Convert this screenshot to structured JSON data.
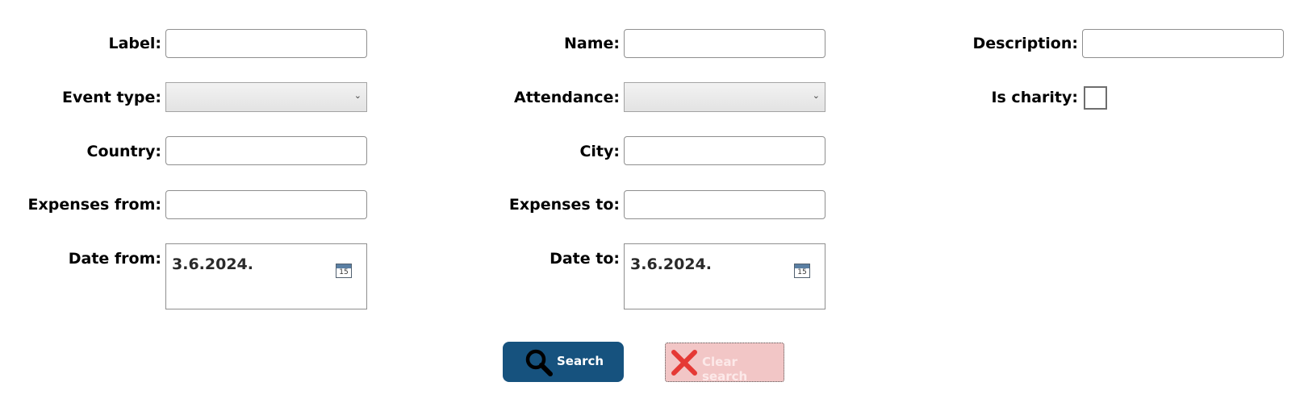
{
  "form": {
    "label_label": "Label:",
    "label_value": "",
    "name_label": "Name:",
    "name_value": "",
    "description_label": "Description:",
    "description_value": "",
    "event_type_label": "Event type:",
    "event_type_value": "",
    "attendance_label": "Attendance:",
    "attendance_value": "",
    "is_charity_label": "Is charity:",
    "is_charity_checked": false,
    "country_label": "Country:",
    "country_value": "",
    "city_label": "City:",
    "city_value": "",
    "expenses_from_label": "Expenses from:",
    "expenses_from_value": "",
    "expenses_to_label": "Expenses to:",
    "expenses_to_value": "",
    "date_from_label": "Date from:",
    "date_from_value": "3.6.2024.",
    "date_to_label": "Date to:",
    "date_to_value": "3.6.2024.",
    "calendar_day": "15"
  },
  "buttons": {
    "search_label": "Search",
    "search_icon": "search-icon",
    "clear_label": "Clear search",
    "clear_icon": "close-icon"
  },
  "colors": {
    "search_button": "#16527e",
    "clear_button": "#f2c6c6",
    "clear_icon": "#e53935"
  }
}
